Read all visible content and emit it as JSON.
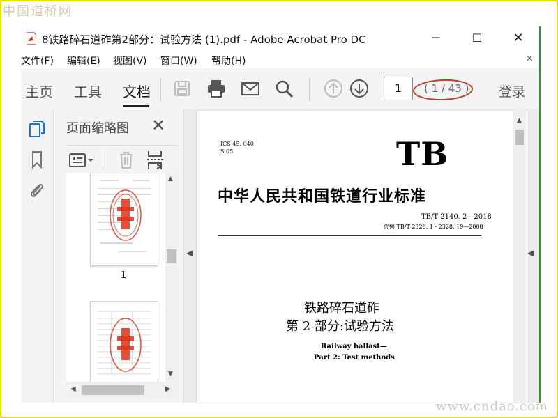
{
  "watermark": {
    "top": "中国道桥网",
    "bottom": "www.cndao.com"
  },
  "window": {
    "title": "8铁路碎石道砟第2部分：试验方法 (1).pdf - Adobe Acrobat Pro DC",
    "controls": {
      "minimize": "−",
      "maximize": "☐",
      "close": "✕"
    }
  },
  "menu": {
    "items": [
      "文件(F)",
      "编辑(E)",
      "视图(V)",
      "窗口(W)",
      "帮助(H)"
    ],
    "close": "×"
  },
  "toolbar": {
    "tabs": [
      "主页",
      "工具",
      "文档"
    ],
    "active_tab": "文档",
    "page_input": "1",
    "page_count": "( 1 / 43 )",
    "login": "登录"
  },
  "panel": {
    "title": "页面缩略图",
    "close": "✕",
    "thumbnails": [
      {
        "label": "1"
      },
      {
        "label": ""
      }
    ]
  },
  "document": {
    "ics": "ICS 45. 040",
    "s_code": "S 05",
    "logo": "TB",
    "standard_title": "中华人民共和国铁道行业标准",
    "code": "TB/T 2140. 2—2018",
    "replaces": "代替 TB/T 2328. 1 - 2328. 19—2008",
    "title_line1": "铁路碎石道砟",
    "title_line2": "第 2 部分:试验方法",
    "en_line1": "Railway ballast—",
    "en_line2": "Part 2: Test methods"
  },
  "colors": {
    "accent_frame": "#e9e100",
    "annotation": "#c03a26",
    "stamp": "#e0311a"
  }
}
